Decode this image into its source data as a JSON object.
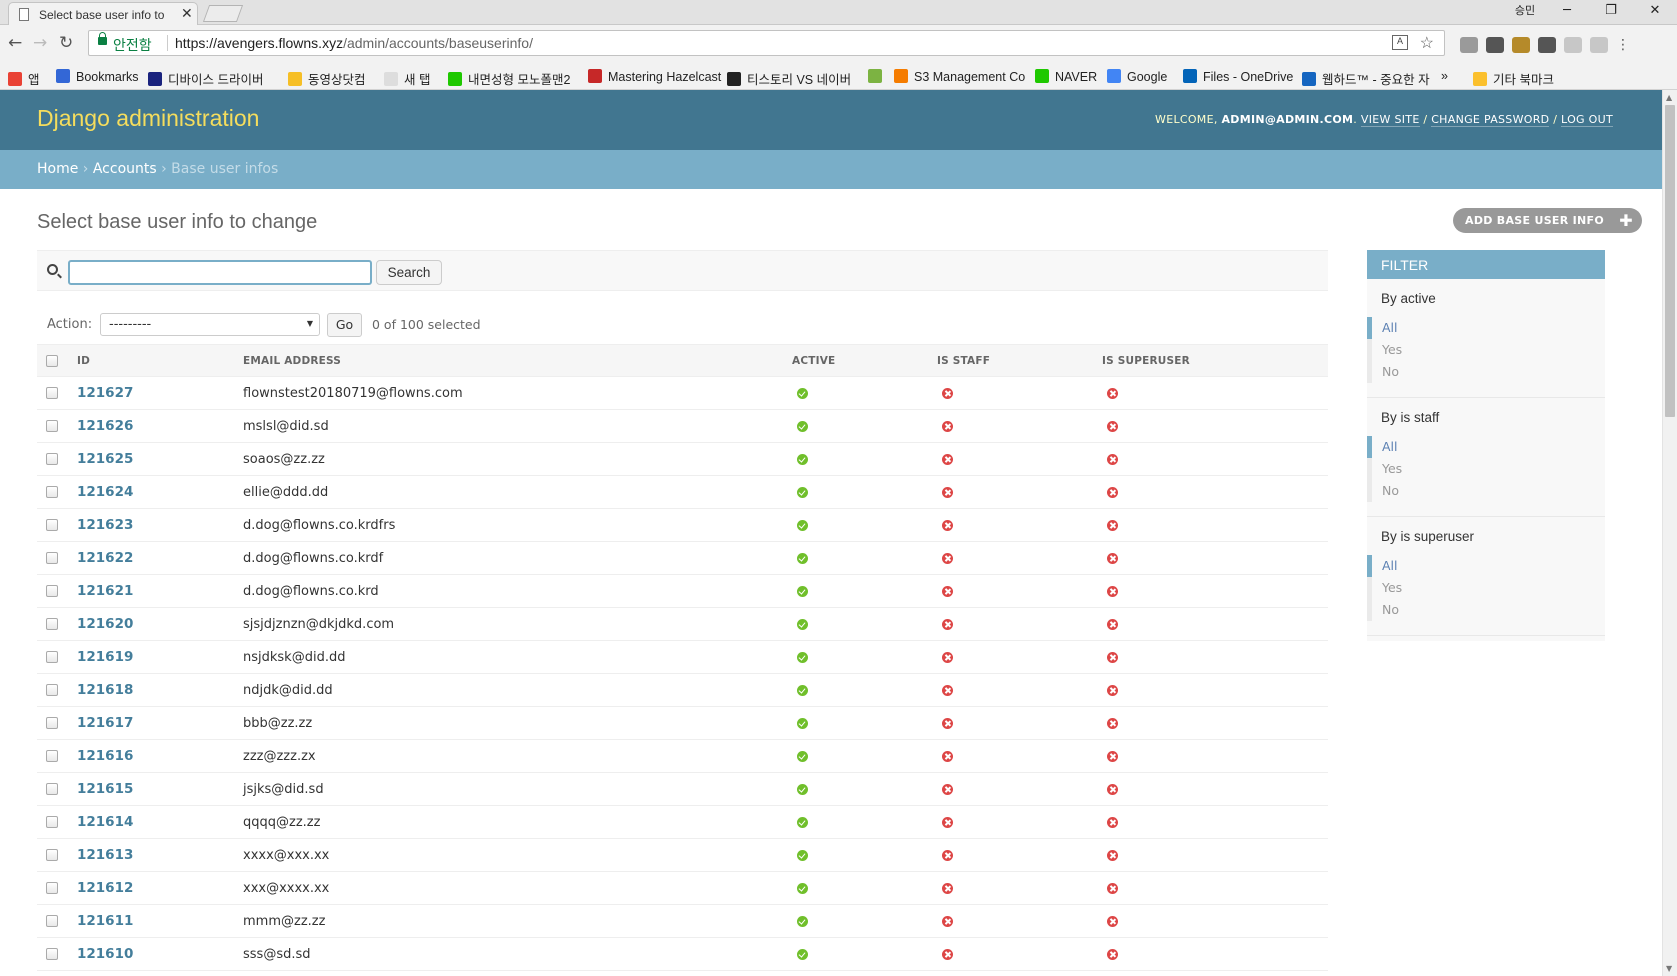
{
  "browser": {
    "tab_title": "Select base user info to",
    "profile_label": "승민",
    "secure_label": "안전함",
    "url_host": "https://avengers.flowns.xyz",
    "url_path": "/admin/accounts/baseuserinfo/",
    "bookmarks": [
      {
        "label": "앱",
        "color": "#e94235"
      },
      {
        "label": "Bookmarks",
        "color": "#3367d6"
      },
      {
        "label": "디바이스 드라이버",
        "color": "#1a237e"
      },
      {
        "label": "동영상닷컴",
        "color": "#f6bf26"
      },
      {
        "label": "새 탭",
        "color": "#dddddd"
      },
      {
        "label": "내면성형 모노폴맨2",
        "color": "#1ec800"
      },
      {
        "label": "Mastering Hazelcast",
        "color": "#c62828"
      },
      {
        "label": "티스토리 VS 네이버",
        "color": "#222222"
      },
      {
        "label": "",
        "color": "#7cb342"
      },
      {
        "label": "S3 Management Co",
        "color": "#f57c00"
      },
      {
        "label": "NAVER",
        "color": "#1ec800"
      },
      {
        "label": "Google",
        "color": "#4285f4"
      },
      {
        "label": "Files - OneDrive",
        "color": "#0364b8"
      },
      {
        "label": "웹하드™ - 중요한 자",
        "color": "#1565c0"
      },
      {
        "label": "»",
        "color": ""
      },
      {
        "label": "기타 북마크",
        "color": "#fbc02d"
      }
    ]
  },
  "header": {
    "brand": "Django administration",
    "welcome": "WELCOME,",
    "user": "ADMIN@ADMIN.COM",
    "view_site": "VIEW SITE",
    "change_password": "CHANGE PASSWORD",
    "log_out": "LOG OUT"
  },
  "breadcrumbs": {
    "home": "Home",
    "app": "Accounts",
    "current": "Base user infos"
  },
  "page_title": "Select base user info to change",
  "add_button": "ADD BASE USER INFO",
  "search": {
    "button": "Search",
    "value": ""
  },
  "actions": {
    "label": "Action:",
    "selected": "---------",
    "go": "Go",
    "counter": "0 of 100 selected"
  },
  "table": {
    "headers": [
      "ID",
      "EMAIL ADDRESS",
      "ACTIVE",
      "IS STAFF",
      "IS SUPERUSER"
    ],
    "rows": [
      {
        "id": "121627",
        "email": "flownstest20180719@flowns.com",
        "active": true,
        "staff": false,
        "superuser": false
      },
      {
        "id": "121626",
        "email": "mslsl@did.sd",
        "active": true,
        "staff": false,
        "superuser": false
      },
      {
        "id": "121625",
        "email": "soaos@zz.zz",
        "active": true,
        "staff": false,
        "superuser": false
      },
      {
        "id": "121624",
        "email": "ellie@ddd.dd",
        "active": true,
        "staff": false,
        "superuser": false
      },
      {
        "id": "121623",
        "email": "d.dog@flowns.co.krdfrs",
        "active": true,
        "staff": false,
        "superuser": false
      },
      {
        "id": "121622",
        "email": "d.dog@flowns.co.krdf",
        "active": true,
        "staff": false,
        "superuser": false
      },
      {
        "id": "121621",
        "email": "d.dog@flowns.co.krd",
        "active": true,
        "staff": false,
        "superuser": false
      },
      {
        "id": "121620",
        "email": "sjsjdjznzn@dkjdkd.com",
        "active": true,
        "staff": false,
        "superuser": false
      },
      {
        "id": "121619",
        "email": "nsjdksk@did.dd",
        "active": true,
        "staff": false,
        "superuser": false
      },
      {
        "id": "121618",
        "email": "ndjdk@did.dd",
        "active": true,
        "staff": false,
        "superuser": false
      },
      {
        "id": "121617",
        "email": "bbb@zz.zz",
        "active": true,
        "staff": false,
        "superuser": false
      },
      {
        "id": "121616",
        "email": "zzz@zzz.zx",
        "active": true,
        "staff": false,
        "superuser": false
      },
      {
        "id": "121615",
        "email": "jsjks@did.sd",
        "active": true,
        "staff": false,
        "superuser": false
      },
      {
        "id": "121614",
        "email": "qqqq@zz.zz",
        "active": true,
        "staff": false,
        "superuser": false
      },
      {
        "id": "121613",
        "email": "xxxx@xxx.xx",
        "active": true,
        "staff": false,
        "superuser": false
      },
      {
        "id": "121612",
        "email": "xxx@xxxx.xx",
        "active": true,
        "staff": false,
        "superuser": false
      },
      {
        "id": "121611",
        "email": "mmm@zz.zz",
        "active": true,
        "staff": false,
        "superuser": false
      },
      {
        "id": "121610",
        "email": "sss@sd.sd",
        "active": true,
        "staff": false,
        "superuser": false
      }
    ]
  },
  "filter": {
    "title": "FILTER",
    "groups": [
      {
        "title": "By active",
        "options": [
          "All",
          "Yes",
          "No"
        ],
        "selected": "All"
      },
      {
        "title": "By is staff",
        "options": [
          "All",
          "Yes",
          "No"
        ],
        "selected": "All"
      },
      {
        "title": "By is superuser",
        "options": [
          "All",
          "Yes",
          "No"
        ],
        "selected": "All"
      }
    ]
  },
  "colors": {
    "header": "#417690",
    "breadcrumbs": "#79aec8",
    "brand": "#f5dd5d",
    "link": "#447e9b",
    "yes": "#70bf2b",
    "no": "#dd4646"
  }
}
